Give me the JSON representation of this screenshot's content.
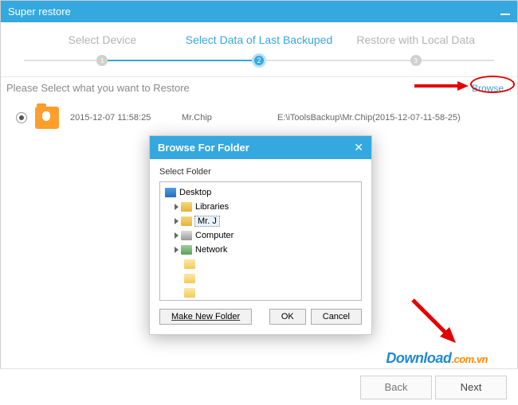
{
  "window": {
    "title": "Super restore"
  },
  "steps": {
    "s1": "Select Device",
    "s2": "Select Data of Last Backuped",
    "s3": "Restore with Local Data",
    "n1": "1",
    "n2": "2",
    "n3": "3"
  },
  "prompt": "Please Select what you want to Restore",
  "browse": "Browse...",
  "backup": {
    "date": "2015-12-07 11:58:25",
    "name": "Mr.Chip",
    "path": "E:\\iToolsBackup\\Mr.Chip(2015-12-07-11-58-25)"
  },
  "dialog": {
    "title": "Browse For Folder",
    "close": "✕",
    "subtitle": "Select Folder",
    "tree": {
      "desktop": "Desktop",
      "libraries": "Libraries",
      "mrj": "Mr. J",
      "computer": "Computer",
      "network": "Network"
    },
    "make": "Make New Folder",
    "ok": "OK",
    "cancel": "Cancel"
  },
  "footer": {
    "back": "Back",
    "next": "Next"
  },
  "watermark": {
    "a": "Download",
    "b": ".com.vn"
  }
}
